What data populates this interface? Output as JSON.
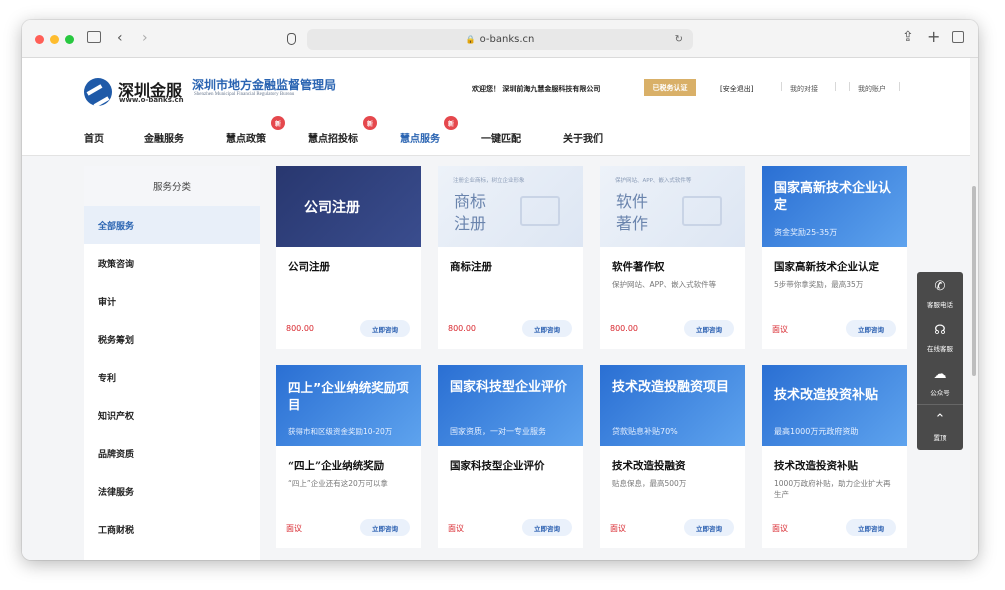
{
  "browser": {
    "url": "o-banks.cn"
  },
  "header": {
    "logo_name": "深圳金服",
    "logo_domain": "www.o-banks.cn",
    "bureau_cn": "深圳市地方金融监督管理局",
    "bureau_en": "Shenzhen Municipal Financial Regulatory Bureau",
    "welcome": "欢迎您！ 深圳前海九慧金服科技有限公司",
    "verified": "已税务认证",
    "logout": "[安全退出]",
    "docking": "我的对接",
    "account": "我的账户"
  },
  "nav": [
    {
      "label": "首页"
    },
    {
      "label": "金融服务"
    },
    {
      "label": "慧点政策",
      "badge": "新"
    },
    {
      "label": "慧点招投标",
      "badge": "新"
    },
    {
      "label": "慧点服务",
      "badge": "新"
    },
    {
      "label": "一键匹配"
    },
    {
      "label": "关于我们"
    }
  ],
  "sidebar": {
    "title": "服务分类",
    "items": [
      "全部服务",
      "政策咨询",
      "审计",
      "税务筹划",
      "专利",
      "知识产权",
      "品牌资质",
      "法律服务",
      "工商财税"
    ]
  },
  "cards": [
    {
      "banner_title": "公司注册",
      "banner_sub": "",
      "title": "公司注册",
      "desc": "",
      "price": "800.00",
      "button": "立即咨询"
    },
    {
      "banner_title": "商标\n注册",
      "banner_sub": "注册企业商标，树立企业形象",
      "title": "商标注册",
      "desc": "",
      "price": "800.00",
      "button": "立即咨询"
    },
    {
      "banner_title": "软件\n著作",
      "banner_sub": "保护网站、APP、嵌入式软件等",
      "title": "软件著作权",
      "desc": "保护网站、APP、嵌入式软件等",
      "price": "800.00",
      "button": "立即咨询"
    },
    {
      "banner_title": "国家高新技术企业认定",
      "banner_sub": "资金奖励25-35万",
      "title": "国家高新技术企业认定",
      "desc": "5步带你拿奖励，最高35万",
      "price": "面议",
      "button": "立即咨询"
    },
    {
      "banner_title": "四上”企业纳统奖励项目",
      "banner_sub": "获得市和区级资金奖励10-20万",
      "title": "“四上”企业纳统奖励",
      "desc": "“四上”企业还有这20万可以拿",
      "price": "面议",
      "button": "立即咨询"
    },
    {
      "banner_title": "国家科技型企业评价",
      "banner_sub": "国家资质，一对一专业服务",
      "title": "国家科技型企业评价",
      "desc": "",
      "price": "面议",
      "button": "立即咨询"
    },
    {
      "banner_title": "技术改造投融资项目",
      "banner_sub": "贷款贴息补贴70%",
      "title": "技术改造投融资",
      "desc": "贴息保息，最高500万",
      "price": "面议",
      "button": "立即咨询"
    },
    {
      "banner_title": "技术改造投资补贴",
      "banner_sub": "最高1000万元政府资助",
      "title": "技术改造投资补贴",
      "desc": "1000万政府补贴，助力企业扩大再生产",
      "price": "面议",
      "button": "立即咨询"
    }
  ],
  "floating": [
    {
      "icon": "phone-icon",
      "label": "客服电话"
    },
    {
      "icon": "headset-icon",
      "label": "在线客服"
    },
    {
      "icon": "wechat-icon",
      "label": "公众号"
    },
    {
      "icon": "top-icon",
      "label": "置顶"
    }
  ],
  "colors": {
    "brand": "#1f5aa8",
    "price": "#d8262d",
    "banner_blue": "#2a6fd3"
  }
}
